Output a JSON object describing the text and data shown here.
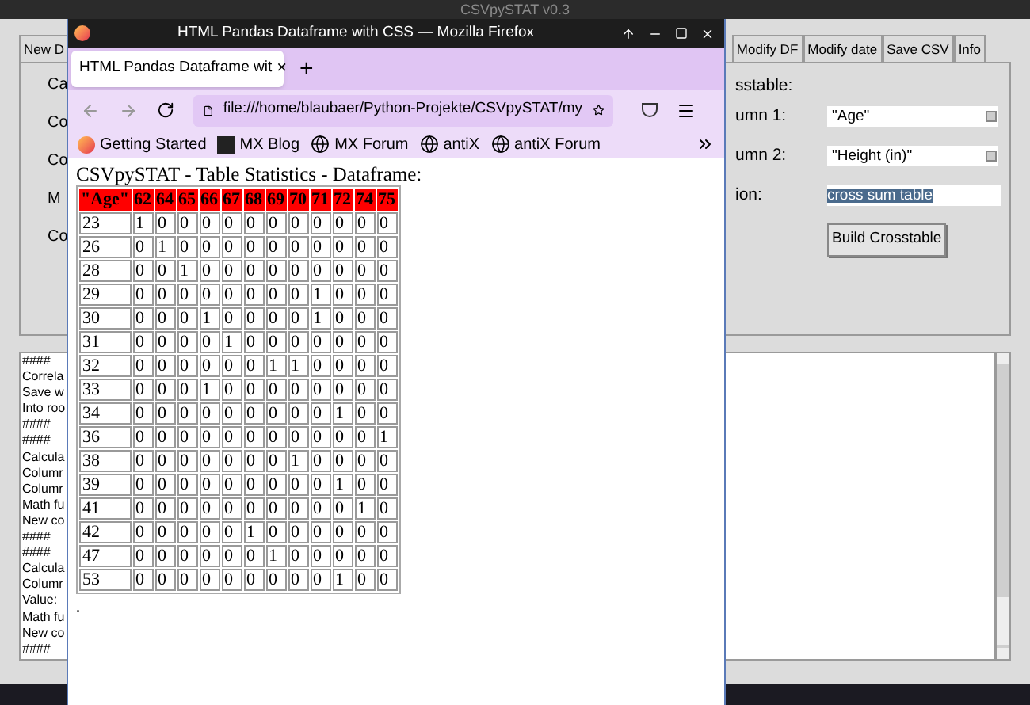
{
  "main_window": {
    "title": "CSVpySTAT v0.3",
    "tabs_left": [
      {
        "label": "New D",
        "selected": false
      }
    ],
    "tabs_right": [
      {
        "label": "Modify DF",
        "selected": false
      },
      {
        "label": "Modify date",
        "selected": false
      },
      {
        "label": "Save CSV",
        "selected": false
      },
      {
        "label": "Info",
        "selected": false
      }
    ],
    "left_labels": [
      "Ca",
      "Co",
      "Co",
      "M",
      "Co"
    ],
    "crosstable_heading": "sstable:",
    "fields": [
      {
        "kind": "combo",
        "label": "umn 1:",
        "value": "\"Age\""
      },
      {
        "kind": "combo",
        "label": "umn 2:",
        "value": "\"Height (in)\""
      },
      {
        "kind": "entry",
        "label": "ion:",
        "value": "cross sum table",
        "selected": true
      }
    ],
    "build_button": "Build Crosstable",
    "log_lines": [
      "####",
      "Correla",
      "Save w",
      "Into roo",
      "####",
      "####",
      "Calcula",
      "Columr",
      "Columr",
      "Math fu",
      "New co",
      "####",
      "####",
      "Calcula",
      "Columr",
      "Value:",
      "Math fu",
      "New co",
      "####"
    ]
  },
  "browser": {
    "title": "HTML Pandas Dataframe with CSS — Mozilla Firefox",
    "tab": "HTML Pandas Dataframe wit",
    "tab_close": "×",
    "new_tab": "+",
    "url": "file:///home/blaubaer/Python-Projekte/CSVpySTAT/my",
    "bookmarks": [
      {
        "kind": "firefox",
        "label": "Getting Started"
      },
      {
        "kind": "mx",
        "label": "MX Blog"
      },
      {
        "kind": "globe",
        "label": "MX Forum"
      },
      {
        "kind": "globe",
        "label": "antiX"
      },
      {
        "kind": "globe",
        "label": "antiX Forum"
      }
    ],
    "page_heading": "CSVpySTAT - Table Statistics - Dataframe:",
    "table": {
      "columns": [
        "\"Age\"",
        "62",
        "64",
        "65",
        "66",
        "67",
        "68",
        "69",
        "70",
        "71",
        "72",
        "74",
        "75"
      ],
      "rows": [
        [
          "23",
          "1",
          "0",
          "0",
          "0",
          "0",
          "0",
          "0",
          "0",
          "0",
          "0",
          "0",
          "0"
        ],
        [
          "26",
          "0",
          "1",
          "0",
          "0",
          "0",
          "0",
          "0",
          "0",
          "0",
          "0",
          "0",
          "0"
        ],
        [
          "28",
          "0",
          "0",
          "1",
          "0",
          "0",
          "0",
          "0",
          "0",
          "0",
          "0",
          "0",
          "0"
        ],
        [
          "29",
          "0",
          "0",
          "0",
          "0",
          "0",
          "0",
          "0",
          "0",
          "1",
          "0",
          "0",
          "0"
        ],
        [
          "30",
          "0",
          "0",
          "0",
          "1",
          "0",
          "0",
          "0",
          "0",
          "1",
          "0",
          "0",
          "0"
        ],
        [
          "31",
          "0",
          "0",
          "0",
          "0",
          "1",
          "0",
          "0",
          "0",
          "0",
          "0",
          "0",
          "0"
        ],
        [
          "32",
          "0",
          "0",
          "0",
          "0",
          "0",
          "0",
          "1",
          "1",
          "0",
          "0",
          "0",
          "0"
        ],
        [
          "33",
          "0",
          "0",
          "0",
          "1",
          "0",
          "0",
          "0",
          "0",
          "0",
          "0",
          "0",
          "0"
        ],
        [
          "34",
          "0",
          "0",
          "0",
          "0",
          "0",
          "0",
          "0",
          "0",
          "0",
          "1",
          "0",
          "0"
        ],
        [
          "36",
          "0",
          "0",
          "0",
          "0",
          "0",
          "0",
          "0",
          "0",
          "0",
          "0",
          "0",
          "1"
        ],
        [
          "38",
          "0",
          "0",
          "0",
          "0",
          "0",
          "0",
          "0",
          "1",
          "0",
          "0",
          "0",
          "0"
        ],
        [
          "39",
          "0",
          "0",
          "0",
          "0",
          "0",
          "0",
          "0",
          "0",
          "0",
          "1",
          "0",
          "0"
        ],
        [
          "41",
          "0",
          "0",
          "0",
          "0",
          "0",
          "0",
          "0",
          "0",
          "0",
          "0",
          "1",
          "0"
        ],
        [
          "42",
          "0",
          "0",
          "0",
          "0",
          "0",
          "1",
          "0",
          "0",
          "0",
          "0",
          "0",
          "0"
        ],
        [
          "47",
          "0",
          "0",
          "0",
          "0",
          "0",
          "0",
          "1",
          "0",
          "0",
          "0",
          "0",
          "0"
        ],
        [
          "53",
          "0",
          "0",
          "0",
          "0",
          "0",
          "0",
          "0",
          "0",
          "0",
          "1",
          "0",
          "0"
        ]
      ]
    },
    "trailing_text": "."
  }
}
